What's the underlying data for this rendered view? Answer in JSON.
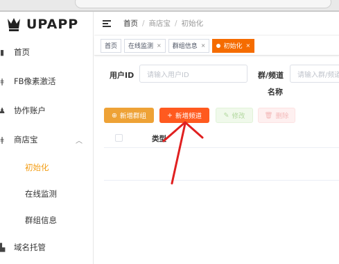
{
  "app": {
    "logo_text": "UPAPP"
  },
  "sidebar": {
    "items": [
      {
        "label": "首页",
        "icon": "home-icon"
      },
      {
        "label": "FB像素激活",
        "icon": "pixel-icon"
      },
      {
        "label": "协作账户",
        "icon": "users-icon"
      },
      {
        "label": "商店宝",
        "icon": "store-icon",
        "expanded": true,
        "children": [
          {
            "label": "初始化",
            "active": true
          },
          {
            "label": "在线监测"
          },
          {
            "label": "群组信息"
          }
        ]
      },
      {
        "label": "域名托管",
        "icon": "domain-icon"
      }
    ],
    "active_color": "#f39c12"
  },
  "header": {
    "breadcrumb": [
      "首页",
      "商店宝",
      "初始化"
    ]
  },
  "tags": [
    {
      "label": "首页"
    },
    {
      "label": "在线监测"
    },
    {
      "label": "群组信息"
    },
    {
      "label": "初始化",
      "active": true
    }
  ],
  "search": {
    "user_id_label": "用户ID",
    "user_id_placeholder": "请输入用户ID",
    "group_label_line1": "群/频道",
    "group_label_line2": "名称",
    "group_placeholder": "请输入群/频道"
  },
  "toolbar": {
    "add_group": "新增群组",
    "add_channel": "新增频道",
    "edit": "修改",
    "delete": "删除"
  },
  "table": {
    "columns": [
      "类型"
    ]
  },
  "annotation": {
    "arrow_color": "#e02020"
  }
}
